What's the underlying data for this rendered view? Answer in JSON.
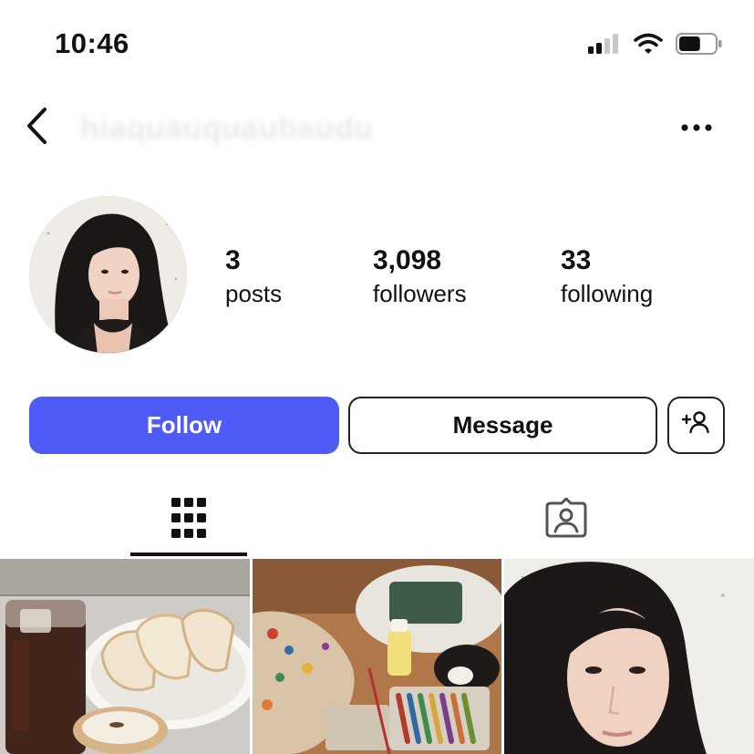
{
  "status_bar": {
    "time": "10:46",
    "icons": [
      "signal-icon",
      "wifi-icon",
      "battery-icon"
    ],
    "battery_level": 0.6
  },
  "header": {
    "username": "hiaquauquaubaudu",
    "back_icon": "chevron-left-icon",
    "more_icon": "more-horizontal-icon"
  },
  "profile": {
    "stats": [
      {
        "value": "3",
        "label": "posts"
      },
      {
        "value": "3,098",
        "label": "followers"
      },
      {
        "value": "33",
        "label": "following"
      }
    ]
  },
  "actions": {
    "follow_label": "Follow",
    "message_label": "Message",
    "add_user_icon": "add-user-icon"
  },
  "tabs": [
    {
      "icon": "grid-icon",
      "active": true
    },
    {
      "icon": "tagged-icon",
      "active": false
    }
  ],
  "posts": [
    {
      "subject": "iced-coffee-and-bread"
    },
    {
      "subject": "paint-palette-and-cat"
    },
    {
      "subject": "selfie-portrait"
    }
  ],
  "colors": {
    "follow_button": "#4f5bf5",
    "text": "#111111",
    "border": "#222222",
    "background": "#ffffff"
  }
}
